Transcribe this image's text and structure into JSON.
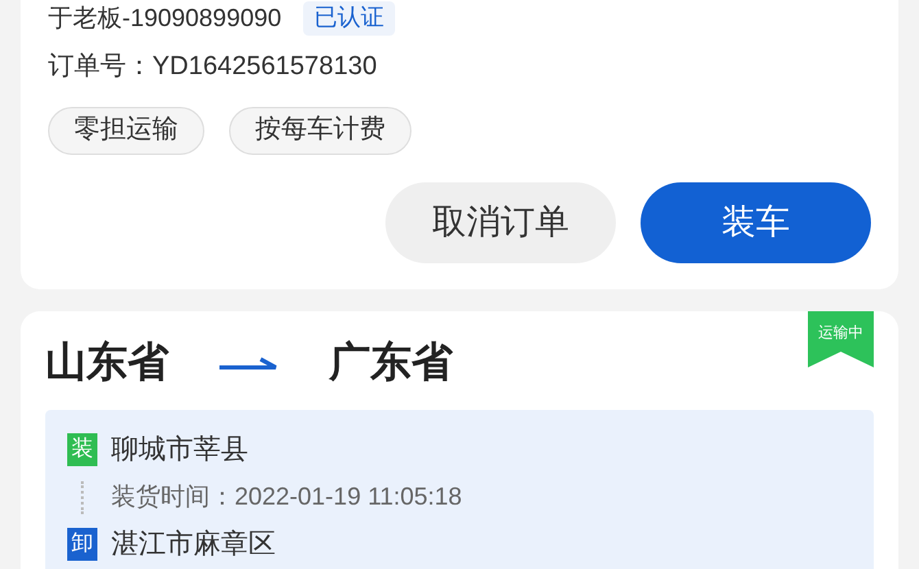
{
  "order_card": {
    "owner": "于老板-19090899090",
    "verified_badge": "已认证",
    "order_number": "订单号：YD1642561578130",
    "tags": [
      "零担运输",
      "按每车计费"
    ],
    "buttons": [
      {
        "label": "取消订单",
        "kind": "secondary"
      },
      {
        "label": "装车",
        "kind": "primary"
      }
    ]
  },
  "route_card": {
    "from": "山东省",
    "to": "广东省",
    "status_ribbon": "运输中",
    "stops": [
      {
        "kind": "load",
        "badge": "装",
        "place": "聊城市莘县",
        "time": "装货时间：2022-01-19 11:05:18"
      },
      {
        "kind": "unload",
        "badge": "卸",
        "place": "湛江市麻章区"
      }
    ]
  }
}
